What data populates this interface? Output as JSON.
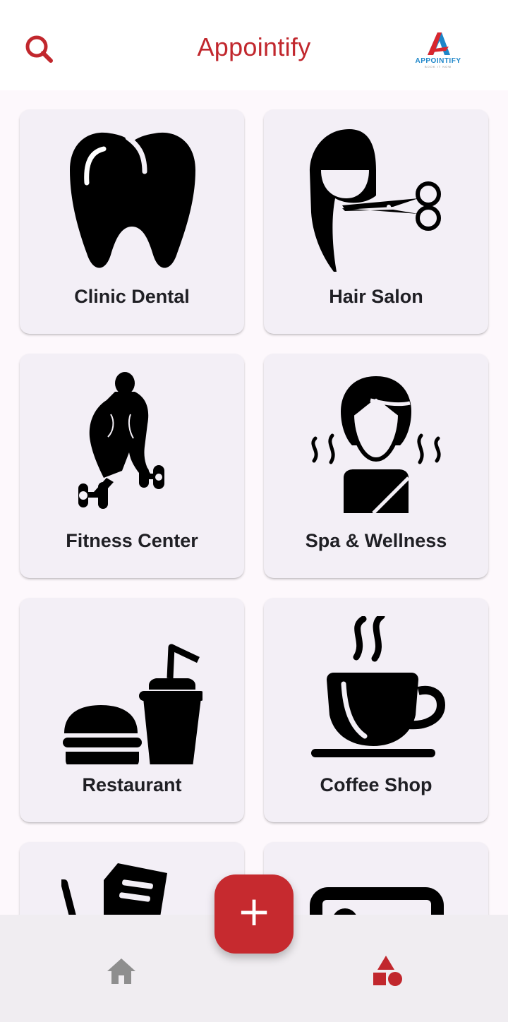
{
  "app": {
    "title": "Appointify",
    "logo_text": "APPOINTIFY",
    "logo_tagline": "BOOK IT NOW",
    "search_icon": "search-icon",
    "accent_color": "#c1272d"
  },
  "categories": [
    {
      "label": "Clinic Dental",
      "icon": "tooth-icon"
    },
    {
      "label": "Hair Salon",
      "icon": "hair-scissors-icon"
    },
    {
      "label": "Fitness Center",
      "icon": "bodybuilder-dumbbell-icon"
    },
    {
      "label": "Spa & Wellness",
      "icon": "spa-woman-icon"
    },
    {
      "label": "Restaurant",
      "icon": "burger-drink-icon"
    },
    {
      "label": "Coffee Shop",
      "icon": "coffee-cup-icon"
    },
    {
      "label": "",
      "icon": "shopping-cart-icon"
    },
    {
      "label": "",
      "icon": "photo-frame-icon"
    }
  ],
  "fab": {
    "label": "+",
    "icon": "plus-icon"
  },
  "bottom_nav": {
    "items": [
      {
        "icon": "home-icon",
        "color": "#8e8e8e"
      },
      {
        "icon": "shapes-icon",
        "color": "#c1272d"
      }
    ]
  }
}
